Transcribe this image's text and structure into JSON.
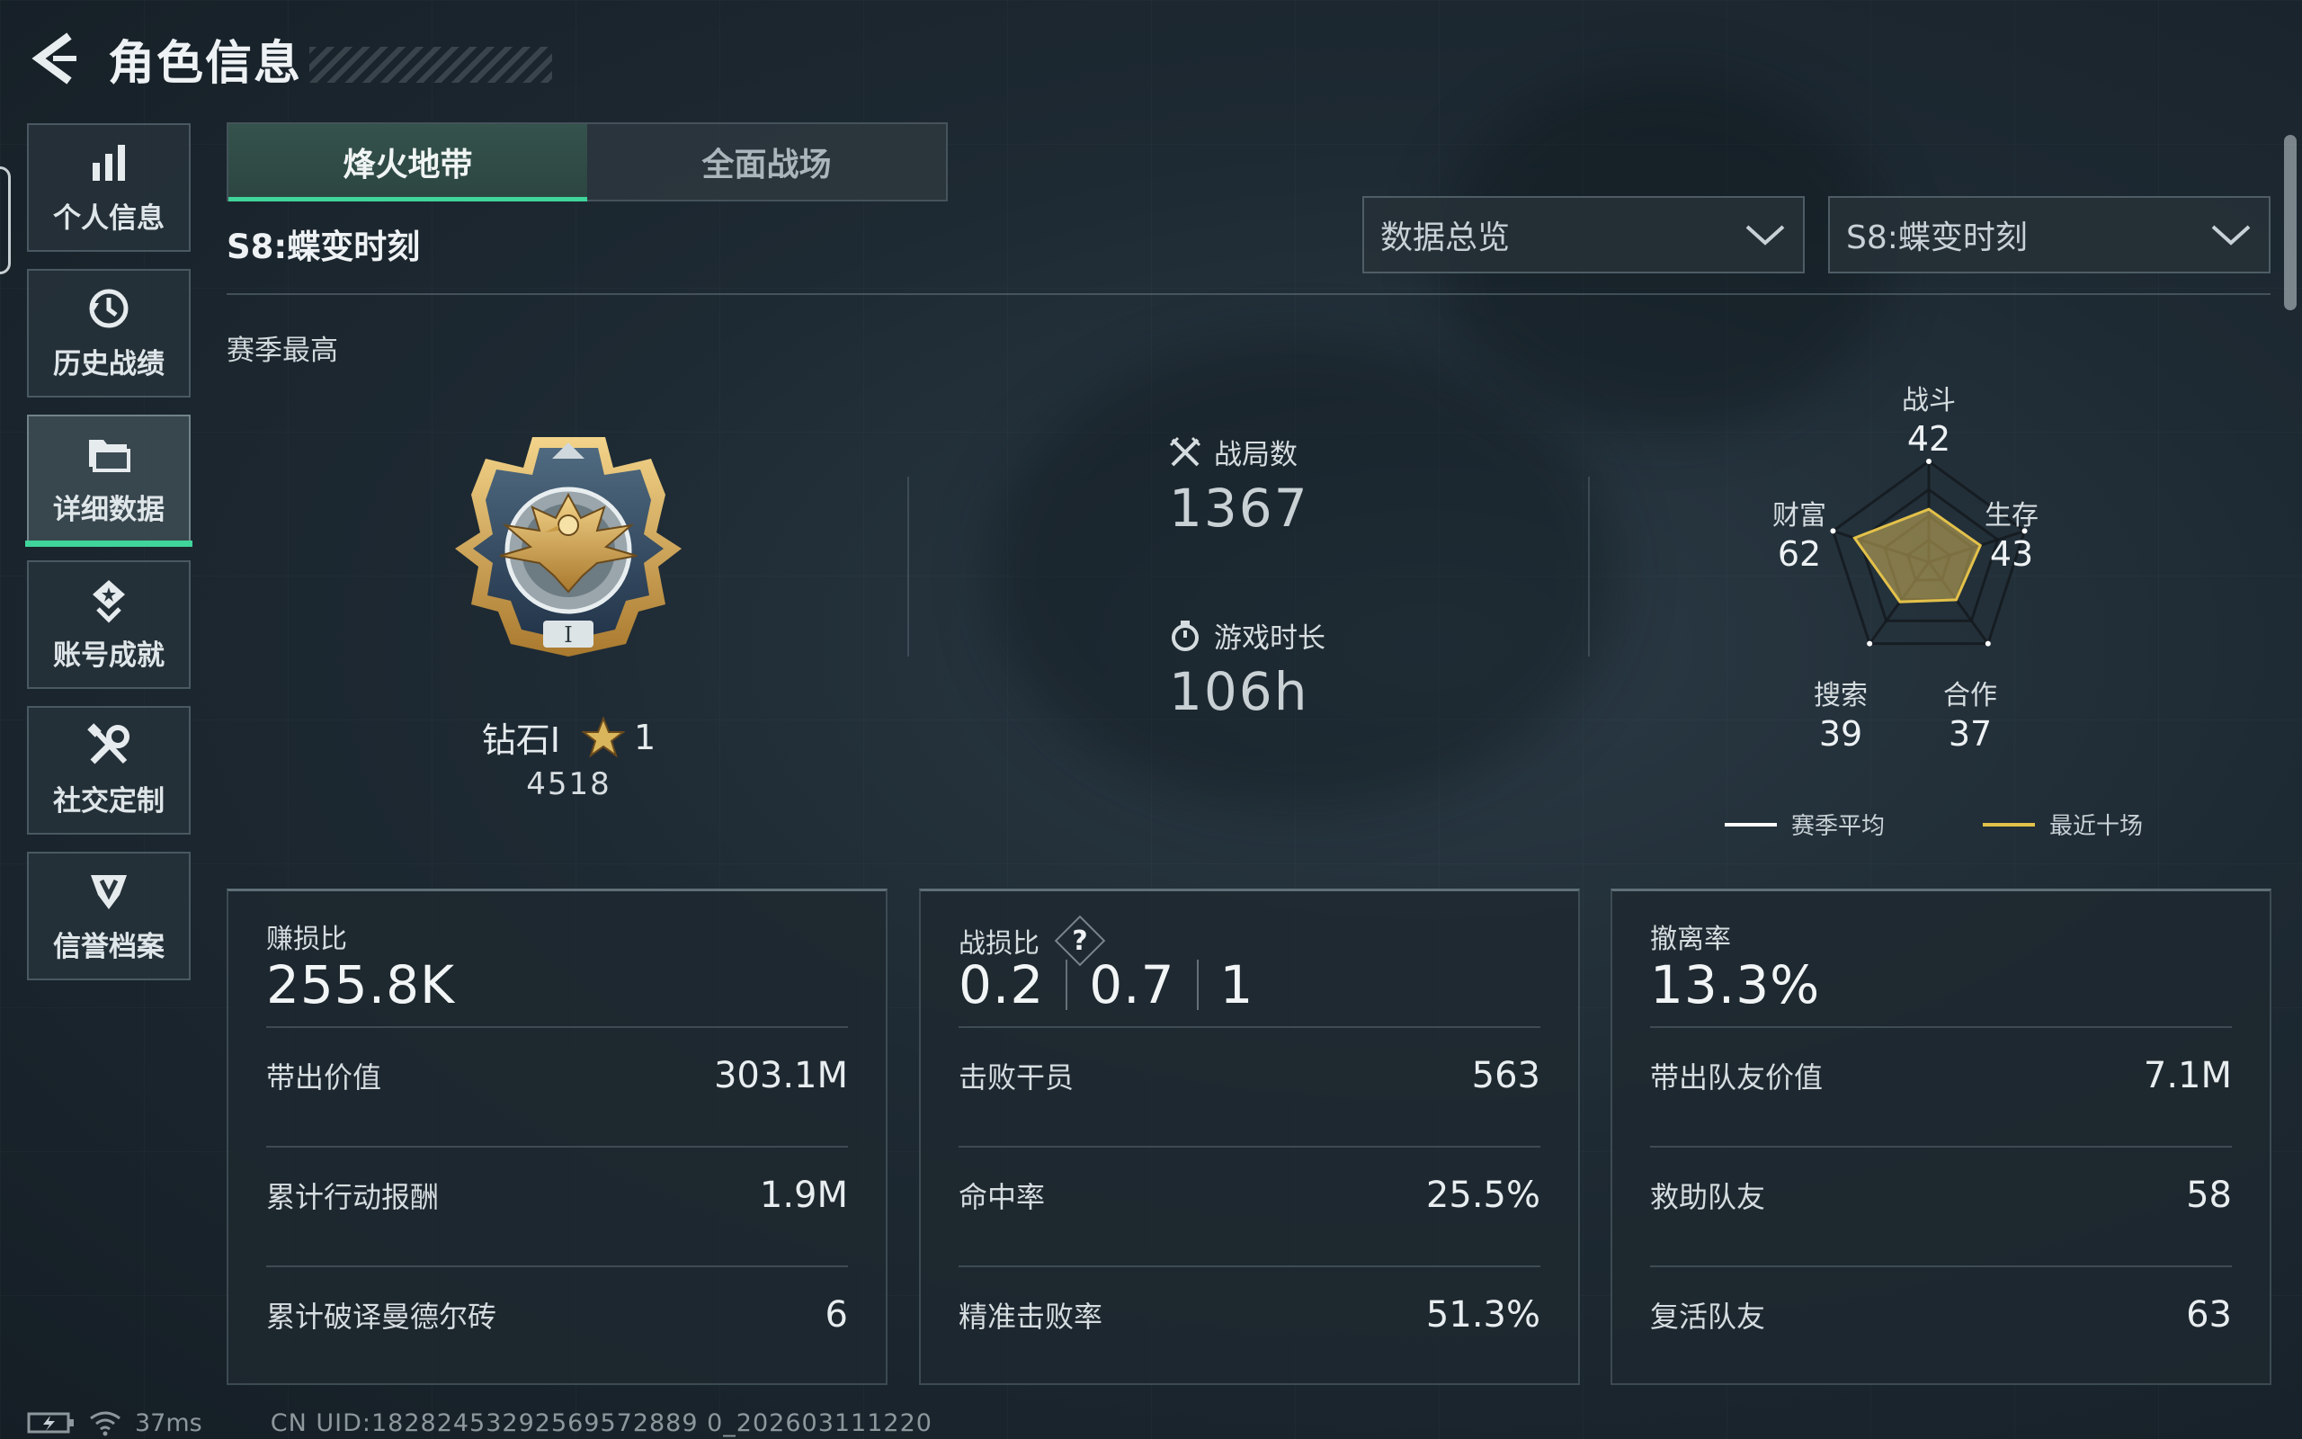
{
  "header": {
    "title": "角色信息"
  },
  "sidebar": {
    "items": [
      {
        "label": "个人信息",
        "icon": "bar-chart-icon"
      },
      {
        "label": "历史战绩",
        "icon": "history-icon"
      },
      {
        "label": "详细数据",
        "icon": "folder-icon",
        "active": true
      },
      {
        "label": "账号成就",
        "icon": "achievement-icon"
      },
      {
        "label": "社交定制",
        "icon": "tools-icon"
      },
      {
        "label": "信誉档案",
        "icon": "shield-icon"
      }
    ]
  },
  "tabs": [
    {
      "label": "烽火地带",
      "active": true
    },
    {
      "label": "全面战场",
      "active": false
    }
  ],
  "season_title": "S8:蝶变时刻",
  "filters": {
    "view": "数据总览",
    "season": "S8:蝶变时刻"
  },
  "season_best_label": "赛季最高",
  "rank": {
    "tier": "钻石Ⅰ",
    "stars": "1",
    "score": "4518"
  },
  "center_stats": {
    "matches_label": "战局数",
    "matches_value": "1367",
    "playtime_label": "游戏时长",
    "playtime_value": "106h"
  },
  "radar": {
    "axes": [
      {
        "label": "战斗",
        "value": "42"
      },
      {
        "label": "生存",
        "value": "43"
      },
      {
        "label": "合作",
        "value": "37"
      },
      {
        "label": "搜索",
        "value": "39"
      },
      {
        "label": "财富",
        "value": "62"
      }
    ],
    "legend": {
      "season_avg": "赛季平均",
      "recent_ten": "最近十场"
    },
    "colors": {
      "season_avg": "#ffffff",
      "recent_ten": "#e3c14a"
    }
  },
  "cards": {
    "profit": {
      "label": "赚损比",
      "value": "255.8K",
      "rows": [
        {
          "label": "带出价值",
          "value": "303.1M"
        },
        {
          "label": "累计行动报酬",
          "value": "1.9M"
        },
        {
          "label": "累计破译曼德尔砖",
          "value": "6"
        }
      ]
    },
    "kd": {
      "label": "战损比",
      "values": [
        "0.2",
        "0.7",
        "1"
      ],
      "rows": [
        {
          "label": "击败干员",
          "value": "563"
        },
        {
          "label": "命中率",
          "value": "25.5%"
        },
        {
          "label": "精准击败率",
          "value": "51.3%"
        }
      ]
    },
    "extract": {
      "label": "撤离率",
      "value": "13.3%",
      "rows": [
        {
          "label": "带出队友价值",
          "value": "7.1M"
        },
        {
          "label": "救助队友",
          "value": "58"
        },
        {
          "label": "复活队友",
          "value": "63"
        }
      ]
    }
  },
  "status": {
    "ping": "37ms",
    "uid": "CN UID:18282453292569572889 0_202603111220"
  },
  "accent_color": "#3fd59b"
}
